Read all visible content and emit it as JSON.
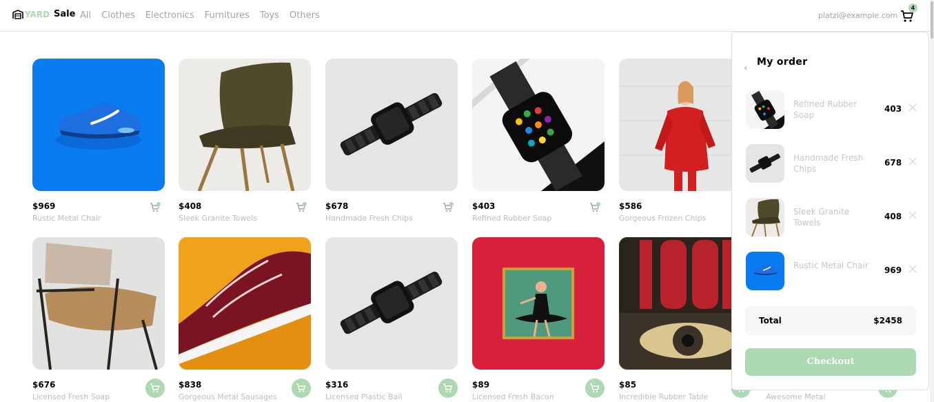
{
  "nav": {
    "logo_part_a": "YARD",
    "logo_part_b": "Sale",
    "links": [
      "All",
      "Clothes",
      "Electronics",
      "Furnitures",
      "Toys",
      "Others"
    ],
    "email": "platzi@example.com",
    "cart_count": "4"
  },
  "colors": {
    "accent": "#acd9b2",
    "muted_text": "#a3a3a3",
    "border": "#dedede"
  },
  "products": [
    {
      "price": "$969",
      "name": "Rustic Metal Chair",
      "image": "blue-sneaker"
    },
    {
      "price": "$408",
      "name": "Sleek Granite Towels",
      "image": "brown-chair"
    },
    {
      "price": "$678",
      "name": "Handmade Fresh Chips",
      "image": "black-watch"
    },
    {
      "price": "$403",
      "name": "Refined Rubber Soap",
      "image": "smart-watch"
    },
    {
      "price": "$586",
      "name": "Gorgeous Frozen Chips",
      "image": "red-sweater"
    },
    {
      "price": "$676",
      "name": "Licensed Fresh Soap",
      "image": "leather-chair"
    },
    {
      "price": "$838",
      "name": "Gorgeous Metal Sausages",
      "image": "burgundy-sneaker"
    },
    {
      "price": "$316",
      "name": "Licensed Plastic Ball",
      "image": "black-watch"
    },
    {
      "price": "$89",
      "name": "Licensed Fresh Bacon",
      "image": "album-cover"
    },
    {
      "price": "$85",
      "name": "Incredible Rubber Table",
      "image": "poster-1984"
    },
    {
      "name": "Awesome Metal"
    }
  ],
  "order": {
    "title": "My order",
    "items": [
      {
        "name": "Refined Rubber Soap",
        "price": "403"
      },
      {
        "name": "Handmade Fresh Chips",
        "price": "678"
      },
      {
        "name": "Sleek Granite Towels",
        "price": "408"
      },
      {
        "name": "Rustic Metal Chair",
        "price": "969"
      }
    ],
    "total_label": "Total",
    "total_value": "$2458",
    "checkout_label": "Checkout"
  }
}
